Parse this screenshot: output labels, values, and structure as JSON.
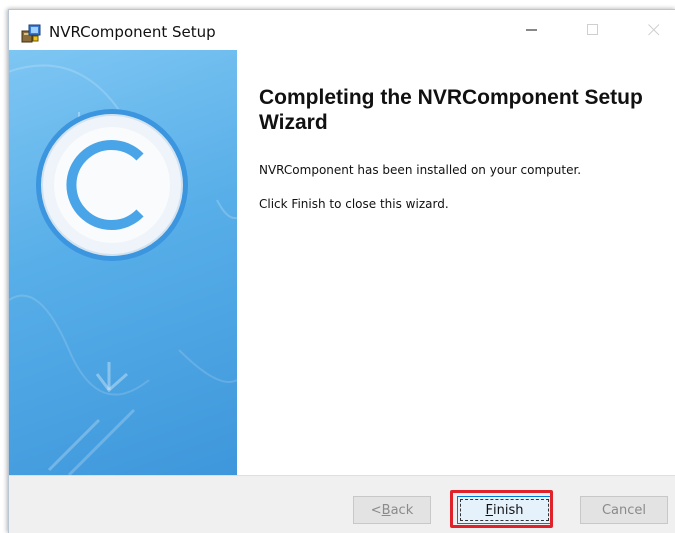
{
  "window": {
    "title": "NVRComponent Setup",
    "app_icon": "installer-icon",
    "controls": [
      "minimize-icon",
      "maximize-icon",
      "close-icon"
    ]
  },
  "content": {
    "heading": "Completing the NVRComponent Setup Wizard",
    "line1": "NVRComponent has been installed on your computer.",
    "line2": "Click Finish to close this wizard."
  },
  "buttons": {
    "back_prefix": "< ",
    "back_accel": "B",
    "back_rest": "ack",
    "finish_accel": "F",
    "finish_rest": "inish",
    "cancel": "Cancel"
  },
  "colors": {
    "side_panel": "#57aee8",
    "highlight": "#e0232b",
    "focus_border": "#0078d7"
  }
}
